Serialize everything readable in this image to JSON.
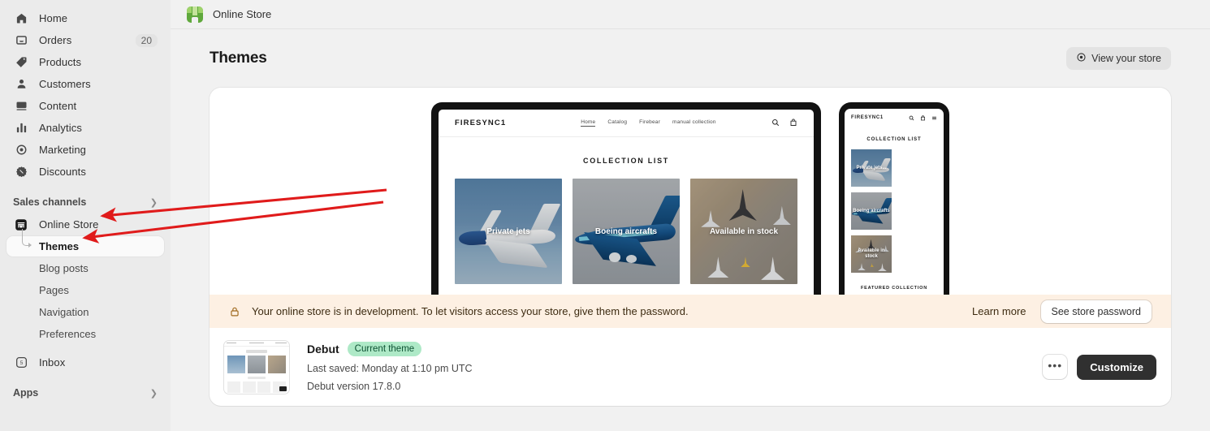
{
  "sidebar": {
    "items": [
      {
        "label": "Home",
        "icon": "home-icon",
        "badge": ""
      },
      {
        "label": "Orders",
        "icon": "orders-icon",
        "badge": "20"
      },
      {
        "label": "Products",
        "icon": "products-tag-icon",
        "badge": ""
      },
      {
        "label": "Customers",
        "icon": "customers-person-icon",
        "badge": ""
      },
      {
        "label": "Content",
        "icon": "content-image-icon",
        "badge": ""
      },
      {
        "label": "Analytics",
        "icon": "analytics-bars-icon",
        "badge": ""
      },
      {
        "label": "Marketing",
        "icon": "marketing-target-icon",
        "badge": ""
      },
      {
        "label": "Discounts",
        "icon": "discounts-tag-icon",
        "badge": ""
      }
    ],
    "sales_channels": {
      "label": "Sales channels",
      "chevron": "chevron-right-icon",
      "online_store": "Online Store",
      "sub_items": [
        {
          "label": "Themes",
          "selected": true
        },
        {
          "label": "Blog posts",
          "selected": false
        },
        {
          "label": "Pages",
          "selected": false
        },
        {
          "label": "Navigation",
          "selected": false
        },
        {
          "label": "Preferences",
          "selected": false
        }
      ]
    },
    "inbox": {
      "label": "Inbox",
      "icon": "inbox-icon",
      "count": "5"
    },
    "apps": {
      "label": "Apps",
      "chevron": "chevron-right-icon"
    }
  },
  "topbar": {
    "store_name": "Online Store",
    "logo": "store-logo-icon"
  },
  "page": {
    "title": "Themes",
    "view_store_label": "View your store",
    "view_store_icon": "eye-target-icon"
  },
  "preview": {
    "desktop": {
      "brand": "FIRESYNC1",
      "nav_links": [
        "Home",
        "Catalog",
        "Firebear",
        "manual collection"
      ],
      "search_icon": "search-icon",
      "cart_icon": "shopping-bag-icon",
      "section_heading": "COLLECTION LIST",
      "collections": [
        "Private jets",
        "Boeing aircrafts",
        "Available in stock"
      ]
    },
    "mobile": {
      "brand": "FIRESYNC1",
      "search_icon": "search-icon",
      "cart_icon": "shopping-bag-icon",
      "menu_icon": "hamburger-menu-icon",
      "section_heading": "COLLECTION LIST",
      "collections": [
        "Private jets...",
        "Boeing aircrafts",
        "Available in stock"
      ],
      "featured_heading": "FEATURED COLLECTION"
    }
  },
  "dev_banner": {
    "lock_icon": "lock-icon",
    "message": "Your online store is in development. To let visitors access your store, give them the password.",
    "learn_more": "Learn more",
    "button": "See store password"
  },
  "theme": {
    "thumbnail": "theme-preview-thumbnail",
    "name": "Debut",
    "badge": "Current theme",
    "last_saved": "Last saved: Monday at 1:10 pm UTC",
    "version": "Debut version 17.8.0",
    "more_label": "•••",
    "customize_label": "Customize"
  },
  "colors": {
    "sidebar_bg": "#ebebeb",
    "page_bg": "#f1f1f1",
    "card_bg": "#ffffff",
    "banner_bg": "#fdf0e3",
    "badge_green": "#aee9c7",
    "badge_green_text": "#0c5132",
    "primary_button": "#303030",
    "annotation_arrow": "#e01b1b"
  }
}
